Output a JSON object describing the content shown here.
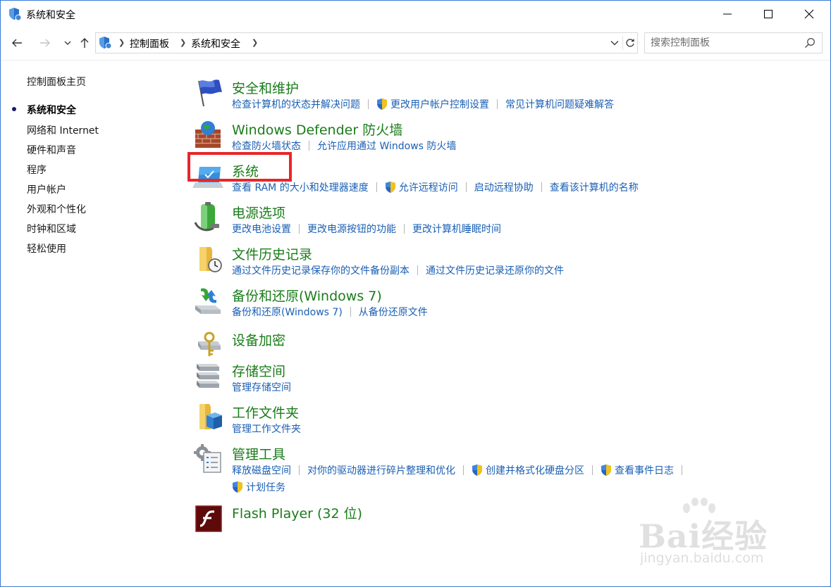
{
  "window": {
    "title": "系统和安全",
    "controls": [
      "minimize",
      "maximize",
      "close"
    ]
  },
  "address_bar": {
    "breadcrumbs": [
      "控制面板",
      "系统和安全"
    ]
  },
  "search": {
    "placeholder": "搜索控制面板"
  },
  "sidebar": {
    "home": "控制面板主页",
    "current": "系统和安全",
    "items": [
      {
        "label": "网络和 Internet"
      },
      {
        "label": "硬件和声音"
      },
      {
        "label": "程序"
      },
      {
        "label": "用户帐户"
      },
      {
        "label": "外观和个性化"
      },
      {
        "label": "时钟和区域"
      },
      {
        "label": "轻松使用"
      }
    ]
  },
  "categories": [
    {
      "title": "安全和维护",
      "icon": "flag-icon",
      "links": [
        {
          "label": "检查计算机的状态并解决问题",
          "shield": false
        },
        {
          "label": "更改用户帐户控制设置",
          "shield": true
        },
        {
          "label": "常见计算机问题疑难解答",
          "shield": false
        }
      ]
    },
    {
      "title": "Windows Defender 防火墙",
      "icon": "firewall-icon",
      "links": [
        {
          "label": "检查防火墙状态",
          "shield": false
        },
        {
          "label": "允许应用通过 Windows 防火墙",
          "shield": false
        }
      ]
    },
    {
      "title": "系统",
      "icon": "system-monitor-icon",
      "links": [
        {
          "label": "查看 RAM 的大小和处理器速度",
          "shield": false
        },
        {
          "label": "允许远程访问",
          "shield": true
        },
        {
          "label": "启动远程协助",
          "shield": false
        },
        {
          "label": "查看该计算机的名称",
          "shield": false
        }
      ]
    },
    {
      "title": "电源选项",
      "icon": "battery-icon",
      "links": [
        {
          "label": "更改电池设置",
          "shield": false
        },
        {
          "label": "更改电源按钮的功能",
          "shield": false
        },
        {
          "label": "更改计算机睡眠时间",
          "shield": false
        }
      ]
    },
    {
      "title": "文件历史记录",
      "icon": "file-history-icon",
      "links": [
        {
          "label": "通过文件历史记录保存你的文件备份副本",
          "shield": false
        },
        {
          "label": "通过文件历史记录还原你的文件",
          "shield": false
        }
      ]
    },
    {
      "title": "备份和还原(Windows 7)",
      "icon": "backup-icon",
      "links": [
        {
          "label": "备份和还原(Windows 7)",
          "shield": false
        },
        {
          "label": "从备份还原文件",
          "shield": false
        }
      ]
    },
    {
      "title": "设备加密",
      "icon": "encryption-key-icon",
      "links": []
    },
    {
      "title": "存储空间",
      "icon": "storage-spaces-icon",
      "links": [
        {
          "label": "管理存储空间",
          "shield": false
        }
      ]
    },
    {
      "title": "工作文件夹",
      "icon": "work-folders-icon",
      "links": [
        {
          "label": "管理工作文件夹",
          "shield": false
        }
      ]
    },
    {
      "title": "管理工具",
      "icon": "admin-tools-icon",
      "links": [
        {
          "label": "释放磁盘空间",
          "shield": false
        },
        {
          "label": "对你的驱动器进行碎片整理和优化",
          "shield": false
        },
        {
          "label": "创建并格式化硬盘分区",
          "shield": true
        },
        {
          "label": "查看事件日志",
          "shield": true
        }
      ],
      "links_row2": [
        {
          "label": "计划任务",
          "shield": true
        }
      ]
    },
    {
      "title": "Flash Player (32 位)",
      "icon": "flash-player-icon",
      "links": []
    }
  ],
  "watermark": {
    "brand": "Bai经验",
    "url": "jingyan.baidu.com"
  },
  "colors": {
    "title_green": "#1a7c1a",
    "link_blue": "#1a5fb4",
    "highlight_red": "#e8262a",
    "window_border": "#3a7bd5"
  }
}
